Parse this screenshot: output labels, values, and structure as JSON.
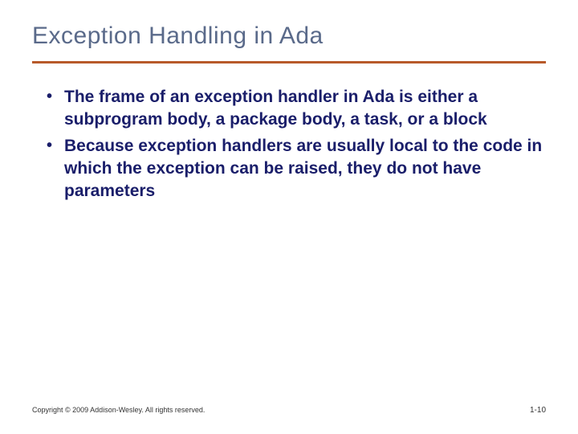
{
  "slide": {
    "title": "Exception Handling in Ada",
    "bullets": [
      "The frame of an exception handler in Ada is either a subprogram body, a package body, a task, or a block",
      "Because exception handlers are usually local to the code in which the exception can be raised, they do not have parameters"
    ],
    "copyright": "Copyright © 2009 Addison-Wesley. All rights reserved.",
    "pagenum": "1-10"
  }
}
